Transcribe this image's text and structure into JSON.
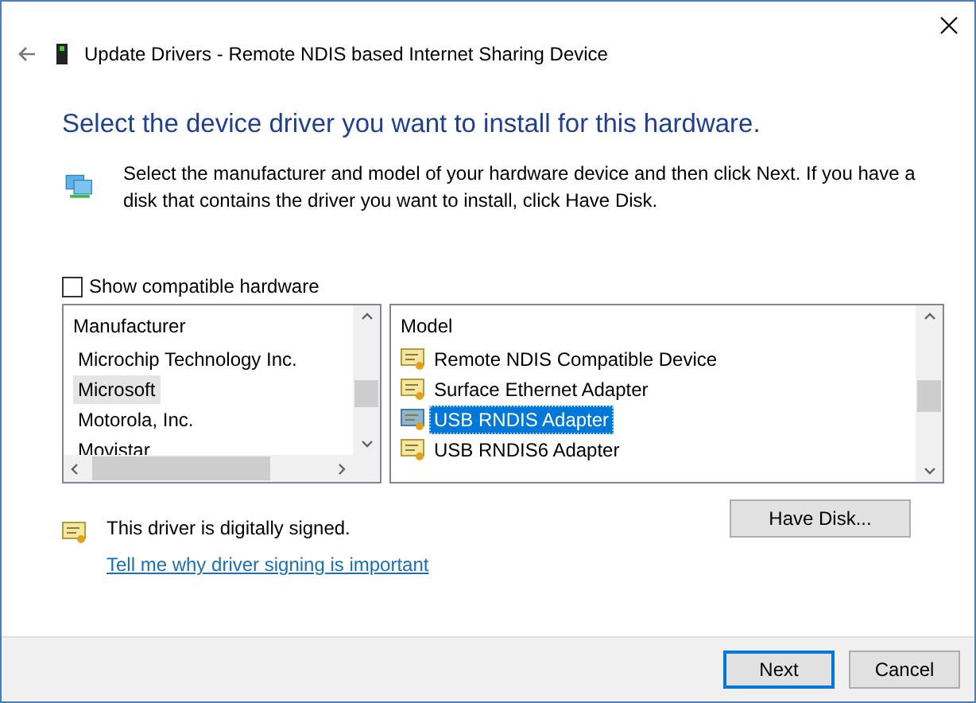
{
  "window": {
    "title": "Update Drivers - Remote NDIS based Internet Sharing Device"
  },
  "heading": "Select the device driver you want to install for this hardware.",
  "description": "Select the manufacturer and model of your hardware device and then click Next. If you have a disk that contains the driver you want to install, click Have Disk.",
  "show_compatible": {
    "label": "Show compatible hardware",
    "checked": false
  },
  "manufacturer_list": {
    "header": "Manufacturer",
    "items": [
      {
        "label": "Microchip Technology Inc.",
        "selected": false
      },
      {
        "label": "Microsoft",
        "selected": true
      },
      {
        "label": "Motorola, Inc.",
        "selected": false
      },
      {
        "label": "Movistar",
        "selected": false
      }
    ]
  },
  "model_list": {
    "header": "Model",
    "items": [
      {
        "label": "Remote NDIS Compatible Device",
        "selected": false
      },
      {
        "label": "Surface Ethernet Adapter",
        "selected": false
      },
      {
        "label": "USB RNDIS Adapter",
        "selected": true
      },
      {
        "label": "USB RNDIS6 Adapter",
        "selected": false
      }
    ]
  },
  "signature": {
    "text": "This driver is digitally signed.",
    "link": "Tell me why driver signing is important"
  },
  "have_disk_button": "Have Disk...",
  "footer_buttons": [
    {
      "label": "Next",
      "default": true
    },
    {
      "label": "Cancel",
      "default": false
    }
  ]
}
